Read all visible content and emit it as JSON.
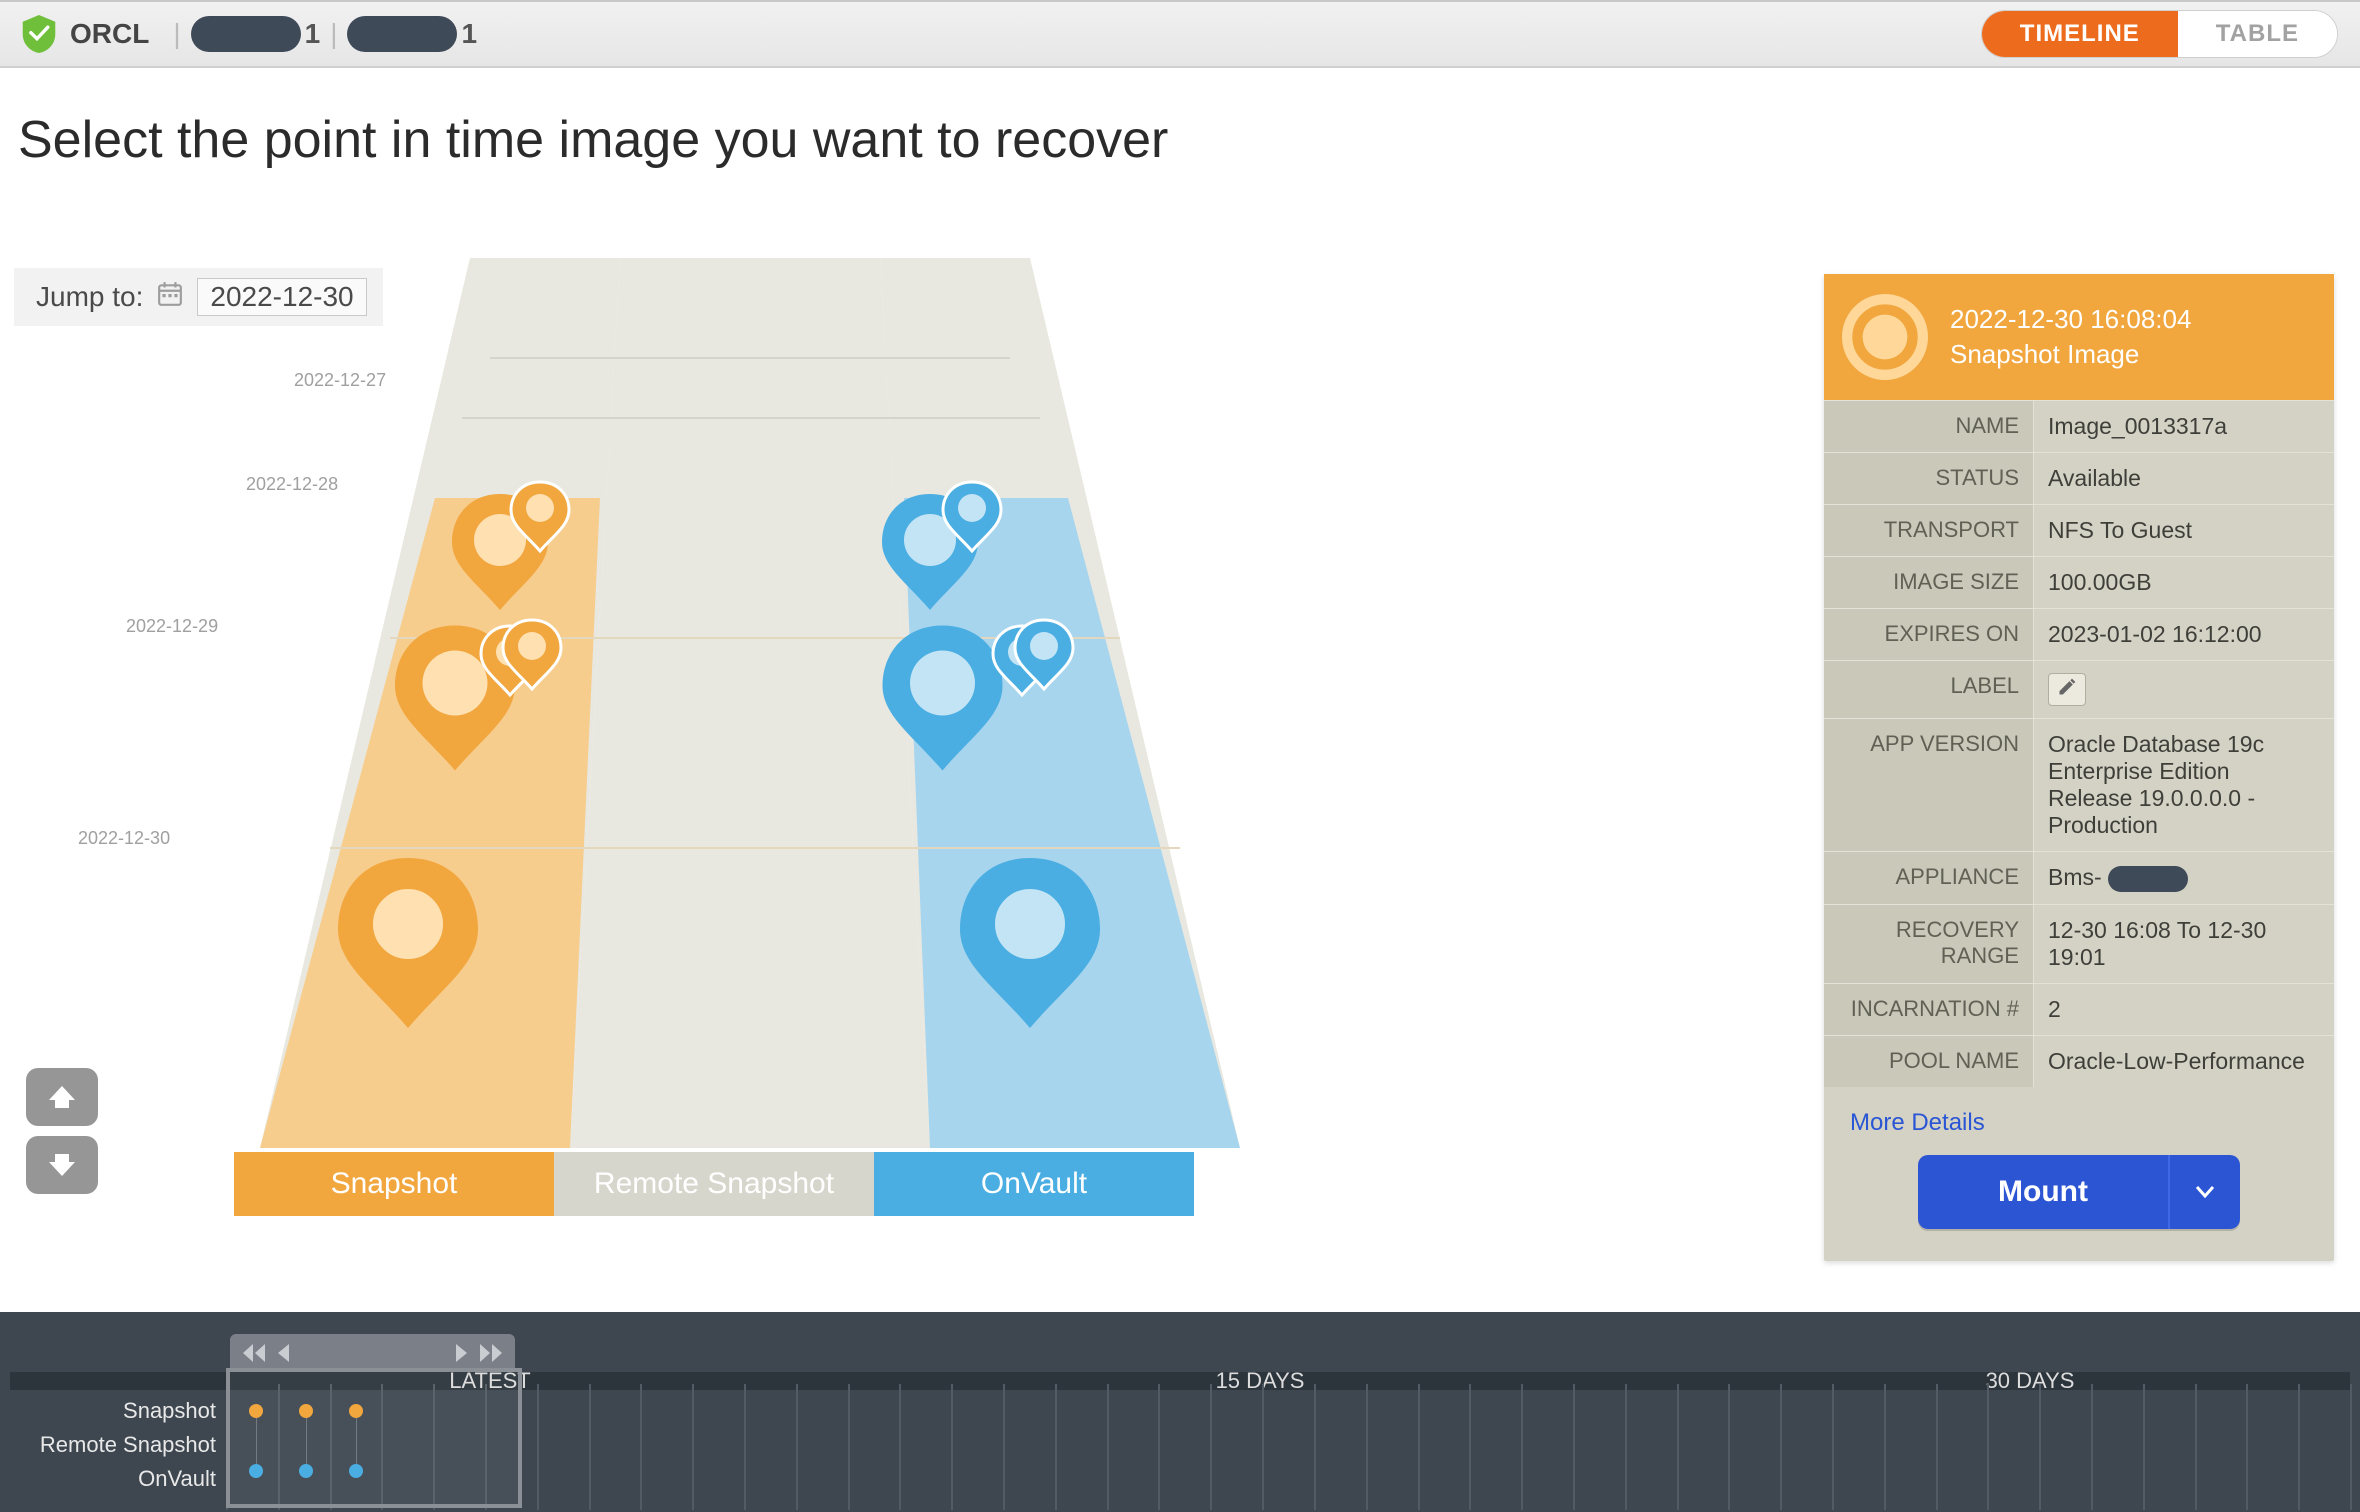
{
  "header": {
    "db_name": "ORCL",
    "host1_suffix": "1",
    "host2_suffix": "1",
    "view_timeline": "TIMELINE",
    "view_table": "TABLE"
  },
  "main": {
    "heading": "Select the point in time image you want to recover",
    "jump_label": "Jump to:",
    "jump_value": "2022-12-30",
    "dates": [
      "2022-12-27",
      "2022-12-28",
      "2022-12-29",
      "2022-12-30"
    ],
    "lanes": {
      "snapshot": "Snapshot",
      "remote": "Remote Snapshot",
      "onvault": "OnVault"
    }
  },
  "detail": {
    "datetime": "2022-12-30  16:08:04",
    "subtitle": "Snapshot Image",
    "rows": {
      "name": {
        "label": "NAME",
        "value": "Image_0013317a"
      },
      "status": {
        "label": "STATUS",
        "value": "Available"
      },
      "transport": {
        "label": "TRANSPORT",
        "value": "NFS To Guest"
      },
      "image_size": {
        "label": "IMAGE SIZE",
        "value": "100.00GB"
      },
      "expires_on": {
        "label": "EXPIRES ON",
        "value": "2023-01-02 16:12:00"
      },
      "label": {
        "label": "LABEL"
      },
      "app_version": {
        "label": "APP VERSION",
        "value": "Oracle Database 19c Enterprise Edition Release 19.0.0.0.0 - Production"
      },
      "appliance": {
        "label": "APPLIANCE",
        "value_prefix": "Bms-"
      },
      "recovery_range": {
        "label": "RECOVERY RANGE",
        "value": "12-30 16:08 To 12-30 19:01"
      },
      "incarnation": {
        "label": "INCARNATION #",
        "value": "2"
      },
      "pool_name": {
        "label": "POOL NAME",
        "value": "Oracle-Low-Performance"
      }
    },
    "more_details": "More Details",
    "mount_label": "Mount"
  },
  "scrubber": {
    "row_labels": [
      "Snapshot",
      "Remote Snapshot",
      "OnVault"
    ],
    "marks": {
      "latest": "LATEST",
      "mid": "15 DAYS",
      "far": "30 DAYS"
    }
  },
  "colors": {
    "snapshot": "#f1a63e",
    "onvault": "#4aaee2",
    "accent": "#ec6b1d",
    "primary": "#2c55d4"
  }
}
